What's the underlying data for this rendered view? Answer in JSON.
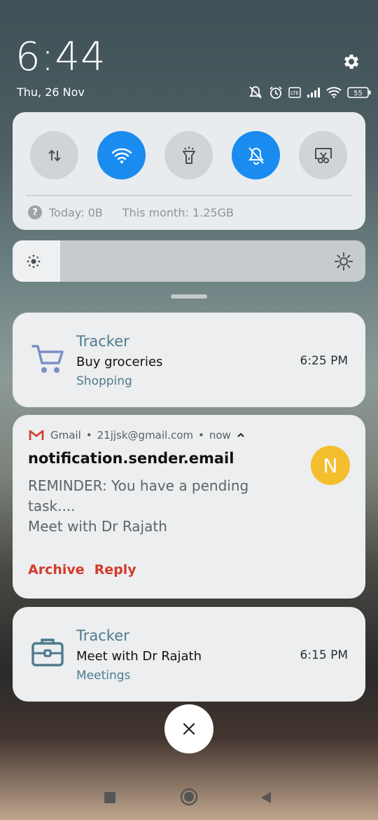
{
  "status_bar": {
    "time": "6:44",
    "date": "Thu, 26 Nov",
    "battery": "55",
    "icons": [
      "dnd-off-icon",
      "alarm-icon",
      "volte-icon",
      "signal-icon",
      "wifi-icon",
      "battery-icon"
    ]
  },
  "quick_settings": {
    "tiles": [
      {
        "name": "mobile-data",
        "icon": "data-transfer-icon",
        "active": false
      },
      {
        "name": "wifi",
        "icon": "wifi-icon",
        "active": true
      },
      {
        "name": "flashlight",
        "icon": "flashlight-icon",
        "active": false
      },
      {
        "name": "mute",
        "icon": "bell-off-icon",
        "active": true
      },
      {
        "name": "screenshot",
        "icon": "scissors-icon",
        "active": false
      }
    ],
    "data_today": "Today: 0B",
    "data_month": "This month: 1.25GB",
    "help_glyph": "?"
  },
  "brightness": {
    "level": 0.135
  },
  "notifications": [
    {
      "app": "Tracker",
      "title": "Buy groceries",
      "category": "Shopping",
      "time": "6:25 PM",
      "icon": "cart-icon"
    },
    {
      "app": "Gmail",
      "account": "21jjsk@gmail.com",
      "when": "now",
      "sender": "notification.sender.email",
      "body_line1": "REMINDER: You have a pending task....",
      "body_line2": "Meet with Dr Rajath",
      "avatar_letter": "N",
      "actions": {
        "archive": "Archive",
        "reply": "Reply"
      }
    },
    {
      "app": "Tracker",
      "title": "Meet with Dr Rajath",
      "category": "Meetings",
      "time": "6:15 PM",
      "icon": "briefcase-icon"
    }
  ],
  "colors": {
    "accent": "#1a8cf0",
    "gmail_red": "#d33a2c",
    "avatar": "#f4be2e",
    "tracker_teal": "#4d7a8d"
  }
}
